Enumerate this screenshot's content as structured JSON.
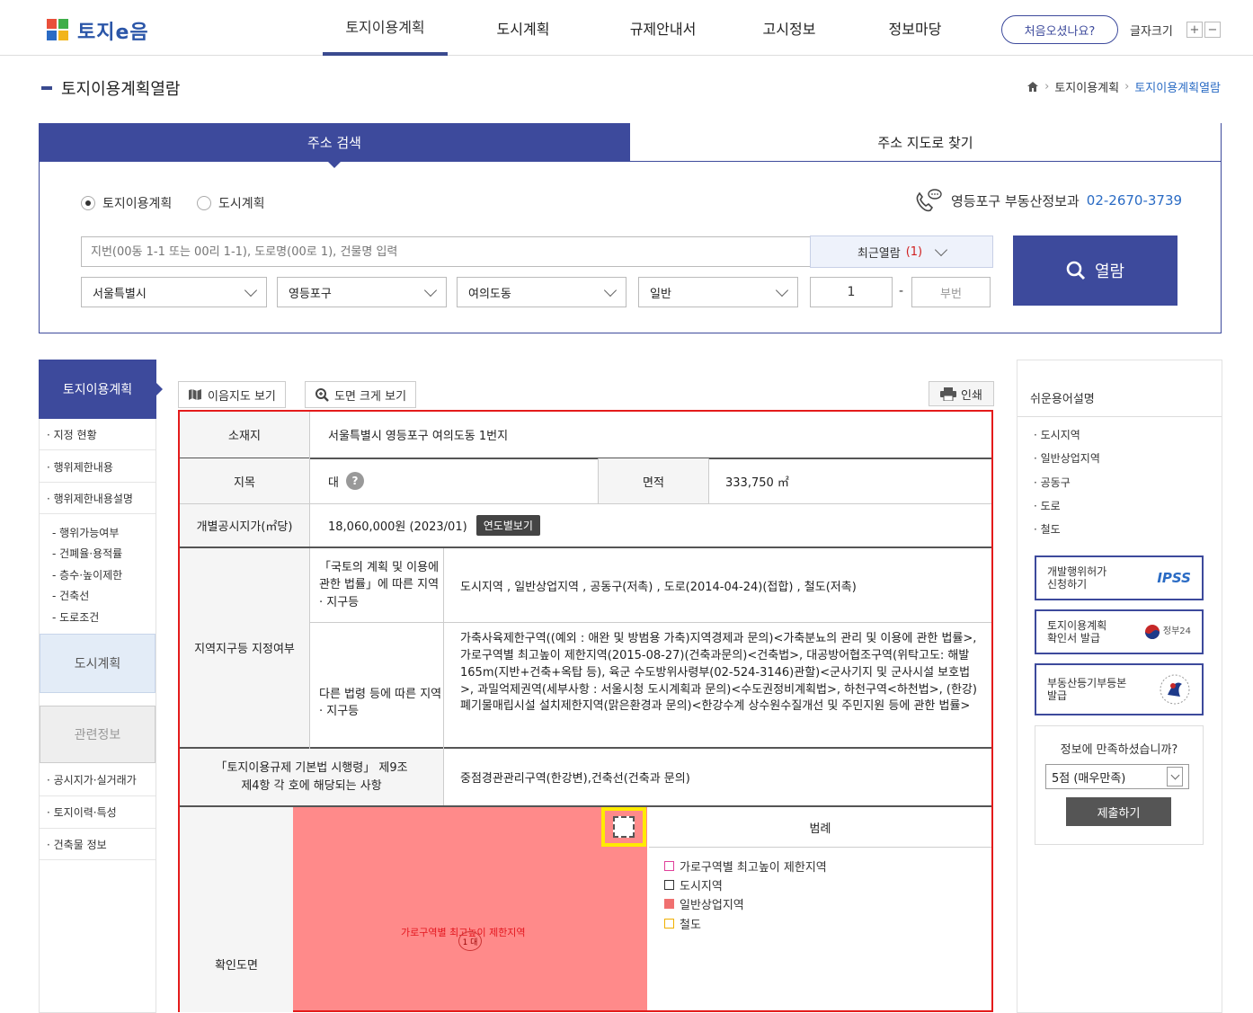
{
  "header": {
    "logo_text": "토지e음",
    "nav": [
      "토지이용계획",
      "도시계획",
      "규제안내서",
      "고시정보",
      "정보마당"
    ],
    "first_visit": "처음오셨나요?",
    "font_size_label": "글자크기",
    "font_plus": "+",
    "font_minus": "−"
  },
  "page": {
    "title": "토지이용계획열람",
    "breadcrumb": [
      "토지이용계획",
      "토지이용계획열람"
    ]
  },
  "search": {
    "tab_active": "주소 검색",
    "tab_other": "주소 지도로 찾기",
    "radio1": "토지이용계획",
    "radio2": "도시계획",
    "phone_label": "영등포구 부동산정보과",
    "phone_number": "02-2670-3739",
    "address_placeholder": "지번(00동 1-1 또는 00리 1-1), 도로명(00로 1), 건물명 입력",
    "recent_label": "최근열람",
    "recent_count": "(1)",
    "sido": "서울특별시",
    "sigungu": "영등포구",
    "dong": "여의도동",
    "type": "일반",
    "bonbun": "1",
    "dash": "-",
    "bubun_placeholder": "부번",
    "open_button": "열람"
  },
  "left_menu": {
    "head": "토지이용계획",
    "items": [
      "· 지정 현황",
      "· 행위제한내용",
      "· 행위제한내용설명"
    ],
    "sub_items": [
      "- 행위가능여부",
      "- 건폐율·용적률",
      "- 층수·높이제한",
      "- 건축선",
      "- 도로조건"
    ],
    "city": "도시계획",
    "related": "관련정보",
    "related_items": [
      "· 공시지가·실거래가",
      "· 토지이력·특성",
      "· 건축물 정보"
    ]
  },
  "toolbar": {
    "map_view": "이음지도 보기",
    "big_view": "도면 크게 보기",
    "print": "인쇄"
  },
  "table": {
    "location_label": "소재지",
    "location_value": "서울특별시 영등포구 여의도동 1번지",
    "jimok_label": "지목",
    "jimok_value": "대",
    "area_label": "면적",
    "area_value": "333,750 ㎡",
    "price_label": "개별공시지가(㎡당)",
    "price_value": "18,060,000원 (2023/01)",
    "year_button": "연도별보기",
    "zone_label": "지역지구등 지정여부",
    "law1_label": "「국토의 계획 및 이용에 관한 법률」에 따른 지역 · 지구등",
    "law1_value": "도시지역 , 일반상업지역 , 공동구(저촉) , 도로(2014-04-24)(접합) , 철도(저촉)",
    "law2_label": "다른 법령 등에 따른 지역 · 지구등",
    "law2_value": "가축사육제한구역((예외 : 애완 및 방범용 가축)지역경제과 문의)<가축분뇨의 관리 및 이용에 관한 법률>, 가로구역별 최고높이 제한지역(2015-08-27)(건축과문의)<건축법>, 대공방어협조구역(위탁고도: 해발165m(지반+건축+옥탑 등), 육군 수도방위사령부(02-524-3146)관할)<군사기지 및 군사시설 보호법>, 과밀억제권역(세부사항 : 서울시청 도시계획과 문의)<수도권정비계획법>, 하천구역<하천법>, (한강)폐기물매립시설 설치제한지역(맑은환경과 문의)<한강수계 상수원수질개선 및 주민지원 등에 관한 법률>",
    "act_label": "「토지이용규제 기본법 시행령」 제9조 제4항 각 호에 해당되는 사항",
    "act_value": "중점경관관리구역(한강변),건축선(건축과 문의)",
    "map_label": "확인도면",
    "legend_title": "범례",
    "legend": [
      {
        "label": "가로구역별 최고높이 제한지역",
        "color": "#e0409a"
      },
      {
        "label": "도시지역",
        "color": "#333333"
      },
      {
        "label": "일반상업지역",
        "color": "#f07070"
      },
      {
        "label": "철도",
        "color": "#f0b000"
      }
    ],
    "map_text": "가로구역별 최고높이 제한지역",
    "map_parcel": "1 대"
  },
  "right": {
    "title": "쉬운용어설명",
    "terms": [
      "· 도시지역",
      "· 일반상업지역",
      "· 공동구",
      "· 도로",
      "· 철도"
    ],
    "box1": "개발행위허가\n신청하기",
    "box1_logo": "IPSS",
    "box2": "토지이용계획\n확인서 발급",
    "box2_logo": "정부24",
    "box3": "부동산등기부등본\n발급",
    "survey_q": "정보에 만족하셨습니까?",
    "survey_value": "5점 (매우만족)",
    "submit": "제출하기"
  }
}
